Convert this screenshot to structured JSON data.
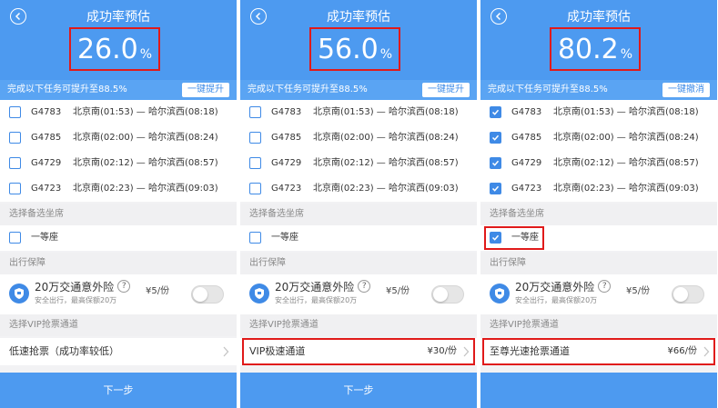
{
  "screens": [
    {
      "title": "成功率预估",
      "rate_value": "26.0",
      "rate_unit": "%",
      "hint": "完成以下任务可提升至88.5%",
      "hint_button": "一键提升",
      "trains": [
        {
          "code": "G4783",
          "route": "北京南(01:53) — 哈尔滨西(08:18)",
          "checked": false
        },
        {
          "code": "G4785",
          "route": "北京南(02:00) — 哈尔滨西(08:24)",
          "checked": false
        },
        {
          "code": "G4729",
          "route": "北京南(02:12) — 哈尔滨西(08:57)",
          "checked": false
        },
        {
          "code": "G4723",
          "route": "北京南(02:23) — 哈尔滨西(09:03)",
          "checked": false
        }
      ],
      "seat_section": "选择备选坐席",
      "seat_label": "一等座",
      "seat_checked": false,
      "insurance_section": "出行保障",
      "insurance_name": "20万交通意外险",
      "insurance_help": "?",
      "insurance_sub": "安全出行，最高保额20万",
      "insurance_price": "¥5/份",
      "vip_section": "选择VIP抢票通道",
      "vip_label": "低速抢票（成功率较低）",
      "vip_price": "",
      "next": "下一步"
    },
    {
      "title": "成功率预估",
      "rate_value": "56.0",
      "rate_unit": "%",
      "hint": "完成以下任务可提升至88.5%",
      "hint_button": "一键提升",
      "trains": [
        {
          "code": "G4783",
          "route": "北京南(01:53) — 哈尔滨西(08:18)",
          "checked": false
        },
        {
          "code": "G4785",
          "route": "北京南(02:00) — 哈尔滨西(08:24)",
          "checked": false
        },
        {
          "code": "G4729",
          "route": "北京南(02:12) — 哈尔滨西(08:57)",
          "checked": false
        },
        {
          "code": "G4723",
          "route": "北京南(02:23) — 哈尔滨西(09:03)",
          "checked": false
        }
      ],
      "seat_section": "选择备选坐席",
      "seat_label": "一等座",
      "seat_checked": false,
      "insurance_section": "出行保障",
      "insurance_name": "20万交通意外险",
      "insurance_help": "?",
      "insurance_sub": "安全出行，最高保额20万",
      "insurance_price": "¥5/份",
      "vip_section": "选择VIP抢票通道",
      "vip_label": "VIP极速通道",
      "vip_price": "¥30/份",
      "next": "下一步"
    },
    {
      "title": "成功率预估",
      "rate_value": "80.2",
      "rate_unit": "%",
      "hint": "完成以下任务可提升至88.5%",
      "hint_button": "一键撤消",
      "trains": [
        {
          "code": "G4783",
          "route": "北京南(01:53) — 哈尔滨西(08:18)",
          "checked": true
        },
        {
          "code": "G4785",
          "route": "北京南(02:00) — 哈尔滨西(08:24)",
          "checked": true
        },
        {
          "code": "G4729",
          "route": "北京南(02:12) — 哈尔滨西(08:57)",
          "checked": true
        },
        {
          "code": "G4723",
          "route": "北京南(02:23) — 哈尔滨西(09:03)",
          "checked": true
        }
      ],
      "seat_section": "选择备选坐席",
      "seat_label": "一等座",
      "seat_checked": true,
      "insurance_section": "出行保障",
      "insurance_name": "20万交通意外险",
      "insurance_help": "?",
      "insurance_sub": "安全出行，最高保额20万",
      "insurance_price": "¥5/份",
      "vip_section": "选择VIP抢票通道",
      "vip_label": "至尊光速抢票通道",
      "vip_price": "¥66/份",
      "next": ""
    }
  ],
  "colors": {
    "header_blue": "#4d9af0",
    "checkbox_blue": "#3f8ae6",
    "highlight_red": "#e01a1a"
  }
}
